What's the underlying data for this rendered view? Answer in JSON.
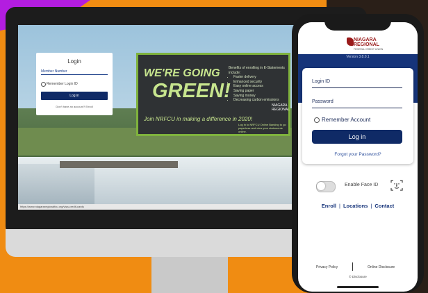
{
  "monitor": {
    "login_card": {
      "title": "Login",
      "member_label": "Member Number",
      "remember_label": "Remember Login ID",
      "button_label": "Log in",
      "no_account": "Don't have an account? Enroll"
    },
    "banner": {
      "headline_1": "WE'RE GOING",
      "headline_2": "GREEN!",
      "join": "Join NRFCU in making a difference in 2020!",
      "benefits_title": "Benefits of enrolling in E-Statements include:",
      "benefits": [
        "Faster delivery",
        "Enhanced security",
        "Easy online access",
        "Saving paper",
        "Saving money",
        "Decreasing carbon emissions"
      ],
      "logo_text": "NIAGARA REGIONAL",
      "note": "Log in to NRFCU Online Banking to go paperless and view your statements online."
    },
    "url": "https://www.niagararegionalfcu.org/visa-credit-cards"
  },
  "phone": {
    "logo_line1": "NIAGARA",
    "logo_line2": "REGIONAL",
    "logo_line3": "FEDERAL CREDIT UNION",
    "version": "Version 3.8.0.1",
    "login_id_label": "Login ID",
    "password_label": "Password",
    "remember_label": "Remember Account",
    "login_button": "Log in",
    "forgot_password": "Forgot your Password?",
    "face_id_label": "Enable Face ID",
    "links": {
      "enroll": "Enroll",
      "locations": "Locations",
      "contact": "Contact"
    },
    "footer": {
      "privacy": "Privacy Policy",
      "disclosure": "Online Disclosure",
      "copyright": "© Disclosure"
    }
  },
  "colors": {
    "brand_navy": "#0f2a66",
    "accent_orange": "#f08c12",
    "green": "#7fb23d"
  }
}
